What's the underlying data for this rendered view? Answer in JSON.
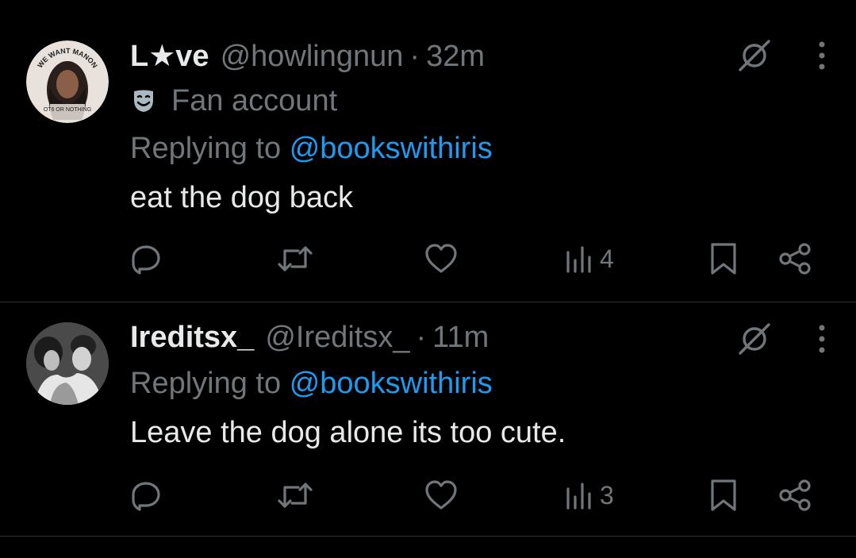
{
  "theme": {
    "background": "#000000",
    "primary_text": "#e7e9ea",
    "secondary_text": "#71767b",
    "link": "#1d9bf0",
    "divider": "#2f3336"
  },
  "tweets": [
    {
      "avatar_text_top": "WE WANT MANON",
      "avatar_text_bottom": "OT6 OR NOTHING",
      "display_name_prefix": "L",
      "display_name_star": "★",
      "display_name_suffix": "ve",
      "handle": "@howlingnun",
      "separator": "·",
      "time": "32m",
      "account_label": "Fan account",
      "account_label_icon": "theater-mask-icon",
      "replying_prefix": "Replying to",
      "replying_to": "@bookswithiris",
      "text": "eat the dog back",
      "views": "4"
    },
    {
      "display_name": "Ireditsx_",
      "handle": "@Ireditsx_",
      "separator": "·",
      "time": "11m",
      "replying_prefix": "Replying to",
      "replying_to": "@bookswithiris",
      "text": "Leave the dog alone its too cute.",
      "views": "3"
    }
  ],
  "icons": {
    "grok": "grok-icon",
    "more": "more-vertical-icon",
    "reply": "reply-icon",
    "retweet": "retweet-icon",
    "like": "heart-icon",
    "views": "views-icon",
    "bookmark": "bookmark-icon",
    "share": "share-icon"
  }
}
